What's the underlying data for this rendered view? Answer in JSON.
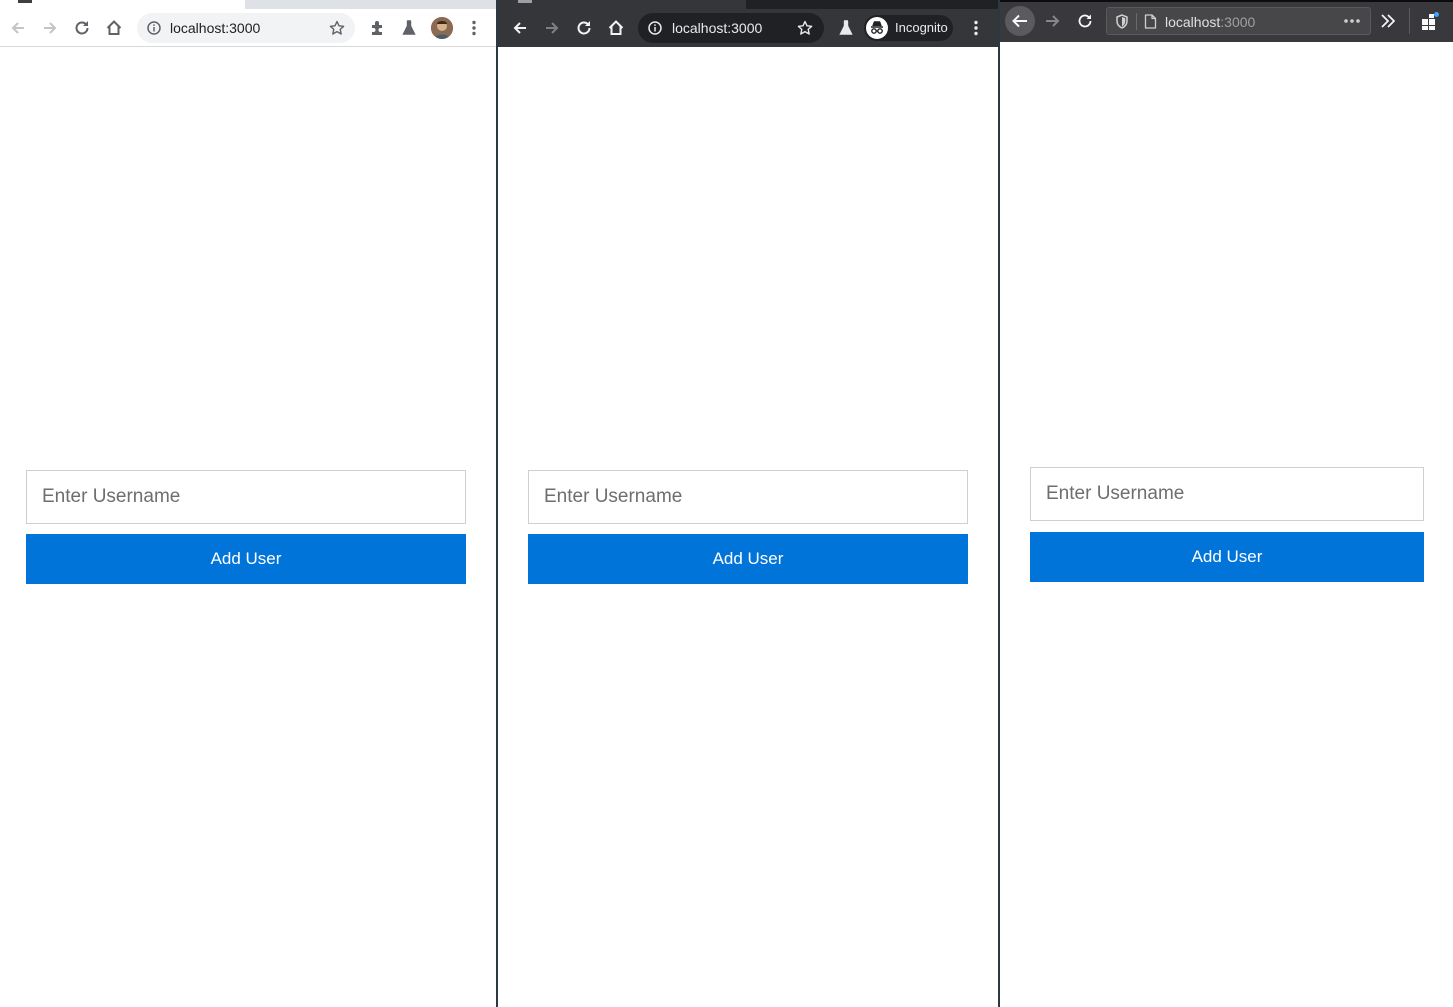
{
  "windows": [
    {
      "browser": "chrome",
      "theme": "light",
      "url": "localhost:3000",
      "icons": [
        "back-icon",
        "forward-icon",
        "reload-icon",
        "home-icon",
        "info-icon",
        "star-icon",
        "extensions-icon",
        "labs-icon",
        "avatar",
        "menu-icon"
      ],
      "form": {
        "username_placeholder": "Enter Username",
        "add_button_label": "Add User"
      }
    },
    {
      "browser": "chrome",
      "theme": "incognito",
      "url": "localhost:3000",
      "incognito_label": "Incognito",
      "icons": [
        "back-icon",
        "forward-icon",
        "reload-icon",
        "home-icon",
        "info-icon",
        "star-icon",
        "labs-icon",
        "incognito-icon",
        "menu-icon"
      ],
      "form": {
        "username_placeholder": "Enter Username",
        "add_button_label": "Add User"
      }
    },
    {
      "browser": "firefox",
      "theme": "dark",
      "url_host": "localhost",
      "url_port": ":3000",
      "icons": [
        "back-icon",
        "forward-icon",
        "reload-icon",
        "shield-icon",
        "page-icon",
        "more-icon",
        "overflow-icon",
        "extensions-icon"
      ],
      "form": {
        "username_placeholder": "Enter Username",
        "add_button_label": "Add User"
      }
    }
  ],
  "colors": {
    "button_bg": "#0074d9",
    "button_text": "#ffffff",
    "chrome_light_toolbar": "#ffffff",
    "chrome_incognito_toolbar": "#35363a",
    "firefox_dark_toolbar": "#38383d"
  }
}
